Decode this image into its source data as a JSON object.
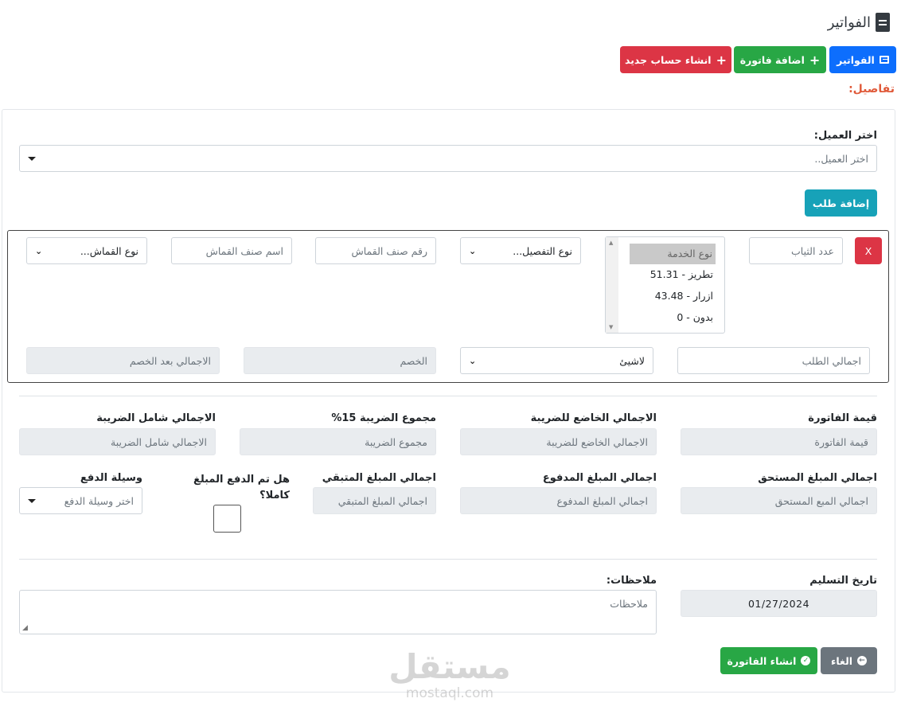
{
  "header": {
    "title": "الفواتير"
  },
  "toolbar": {
    "invoices_label": "الفواتير",
    "add_invoice_label": "اضافة فاتورة",
    "new_account_label": "انشاء حساب جديد"
  },
  "details_label": "تفاصيل:",
  "customer": {
    "label": "اختر العميل:",
    "placeholder": "اختر العميل.."
  },
  "add_request_label": "إضافة طلب",
  "request": {
    "remove_label": "X",
    "clothes_count_placeholder": "عدد الثياب",
    "service_list": [
      "نوع الخدمة",
      "تطريز - 51.31",
      "ازرار - 43.48",
      "بدون - 0"
    ],
    "detail_type_value": "نوع التفصيل...",
    "fabric_number_placeholder": "رقم صنف القماش",
    "fabric_name_placeholder": "اسم صنف القماش",
    "fabric_type_value": "نوع القماش...",
    "request_total_placeholder": "اجمالي الطلب",
    "discount_type_value": "لاشيئ",
    "discount_placeholder": "الخصم",
    "total_after_discount_placeholder": "الاجمالي بعد الخصم"
  },
  "summary": {
    "invoice_value": {
      "label": "قيمة الفاتورة",
      "placeholder": "قيمة الفاتورة"
    },
    "taxable_total": {
      "label": "الاجمالي الخاضع للضريبة",
      "placeholder": "الاجمالي الخاضع للضريبة"
    },
    "tax_sum": {
      "label": "مجموع الضريبة 15%",
      "placeholder": "مجموع الضريبة"
    },
    "total_with_tax": {
      "label": "الاجمالي شامل الضريبة",
      "placeholder": "الاجمالي شامل الضريبة"
    },
    "amount_due": {
      "label": "اجمالي المبلغ المستحق",
      "placeholder": "اجمالي المبع المستحق"
    },
    "amount_paid": {
      "label": "اجمالي المبلغ المدفوع",
      "placeholder": "اجمالي المبلغ المدفوع"
    },
    "amount_remaining": {
      "label": "اجمالي المبلغ المتبقي",
      "placeholder": "اجمالي المبلغ المتبقي"
    },
    "paid_in_full": {
      "label_line1": "هل تم الدفع المبلغ",
      "label_line2": "كاملا؟"
    },
    "payment_method": {
      "label": "وسيلة الدفع",
      "value": "اختر وسيلة الدفع"
    }
  },
  "delivery": {
    "label": "تاريخ التسليم",
    "value": "01/27/2024"
  },
  "notes": {
    "label": "ملاحظات:",
    "placeholder": "ملاحظات"
  },
  "actions": {
    "cancel_label": "الغاء",
    "create_label": "انشاء الفاتورة"
  },
  "watermark": {
    "logo": "مستقل",
    "domain": "mostaql.com"
  },
  "colors": {
    "primary": "#0d6efd",
    "success": "#28a745",
    "danger": "#dc3545",
    "info": "#17a2b8",
    "secondary": "#6c757d",
    "details": "#e05a3a"
  }
}
